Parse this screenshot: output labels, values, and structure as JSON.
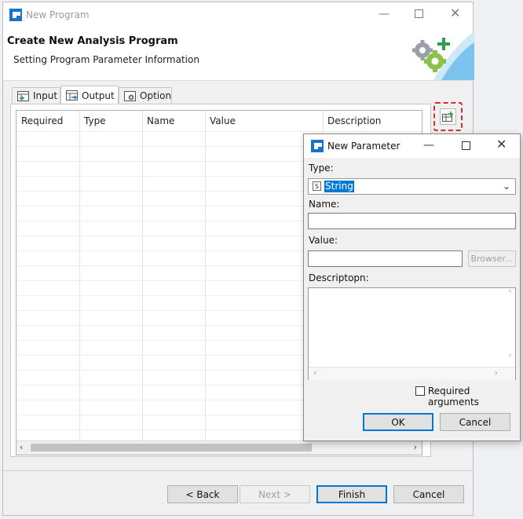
{
  "window": {
    "title": "New Program",
    "header_title": "Create New Analysis Program",
    "header_subtitle": "Setting Program Parameter Information"
  },
  "tabs": [
    {
      "label": "Input",
      "icon": "input-table-icon",
      "selected": false
    },
    {
      "label": "Output",
      "icon": "output-table-icon",
      "selected": true
    },
    {
      "label": "Option",
      "icon": "option-gear-icon",
      "selected": false
    }
  ],
  "table": {
    "columns": [
      "Required",
      "Type",
      "Name",
      "Value",
      "Description"
    ],
    "rows": []
  },
  "footer": {
    "back_label": "< Back",
    "next_label": "Next >",
    "finish_label": "Finish",
    "cancel_label": "Cancel"
  },
  "dialog": {
    "title": "New Parameter",
    "type_label": "Type:",
    "type_value": "String",
    "type_badge": "S",
    "name_label": "Name:",
    "name_value": "",
    "value_label": "Value:",
    "value_value": "",
    "browse_label": "Browser...",
    "description_label": "Descriptopn:",
    "description_value": "",
    "required_label": "Required arguments",
    "required_checked": false,
    "ok_label": "OK",
    "cancel_label": "Cancel"
  },
  "colors": {
    "accent": "#0078d7",
    "highlight_dashed": "#d32f2f",
    "brand_blue": "#1a73c9",
    "brand_green": "#2e9e4a"
  }
}
